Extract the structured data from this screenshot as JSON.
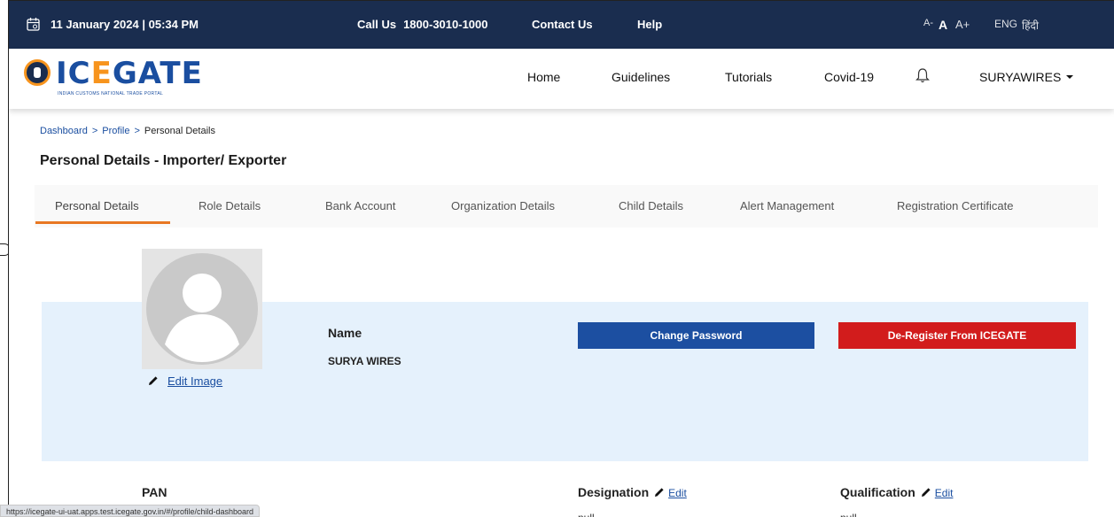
{
  "topbar": {
    "datetime": "11 January 2024 | 05:34 PM",
    "call_label": "Call Us",
    "call_number": "1800-3010-1000",
    "contact": "Contact Us",
    "help": "Help",
    "font_small": "A-",
    "font_normal": "A",
    "font_large": "A+",
    "lang_en": "ENG",
    "lang_hi": "हिंदी",
    "bg_color": "#1a2d4f"
  },
  "header": {
    "logo_text_a": "IC",
    "logo_text_b": "E",
    "logo_text_c": "GATE",
    "logo_sub": "INDIAN CUSTOMS NATIONAL TRADE PORTAL",
    "nav": [
      "Home",
      "Guidelines",
      "Tutorials",
      "Covid-19"
    ],
    "user": "SURYAWIRES"
  },
  "breadcrumb": {
    "items": [
      "Dashboard",
      "Profile",
      "Personal Details"
    ],
    "sep": ">"
  },
  "page_title": "Personal Details - Importer/ Exporter",
  "tabs": [
    "Personal Details",
    "Role Details",
    "Bank Account",
    "Organization Details",
    "Child Details",
    "Alert Management",
    "Registration Certificate"
  ],
  "active_tab": "Personal Details",
  "profile": {
    "edit_image": "Edit Image",
    "name_label": "Name",
    "name_value": "SURYA WIRES",
    "change_password": "Change Password",
    "deregister": "De-Register From ICEGATE"
  },
  "details": {
    "pan_label": "PAN",
    "designation_label": "Designation",
    "qualification_label": "Qualification",
    "edit": "Edit",
    "designation_value": "null",
    "qualification_value": "null"
  },
  "status_url": "https://icegate-ui-uat.apps.test.icegate.gov.in/#/profile/child-dashboard",
  "colors": {
    "accent_orange": "#e87722",
    "primary_blue": "#1c4fa1",
    "danger_red": "#d21c1c",
    "band_blue": "#e5f1fc"
  }
}
